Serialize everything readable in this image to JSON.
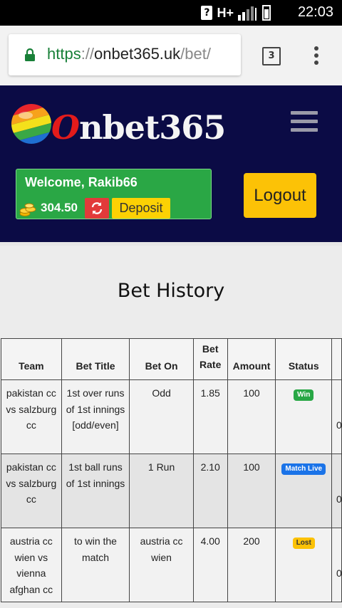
{
  "status_bar": {
    "time": "22:03",
    "network": "H+",
    "sim_icon": "sim-icon"
  },
  "browser": {
    "url_scheme": "https",
    "url_sep": "://",
    "url_host": "onbet365.uk",
    "url_path": "/bet/",
    "tab_count": "3"
  },
  "site": {
    "logo_first": "O",
    "logo_rest": "nbet365",
    "welcome": "Welcome, Rakib66",
    "balance": "304.50",
    "deposit_label": "Deposit",
    "logout_label": "Logout"
  },
  "page": {
    "title": "Bet History"
  },
  "table": {
    "headers": {
      "team": "Team",
      "bet_title": "Bet Title",
      "bet_on": "Bet On",
      "bet_rate": "Bet Rate",
      "amount": "Amount",
      "status": "Status"
    },
    "rows": [
      {
        "team": "pakistan cc vs salzburg cc",
        "bet_title": "1st over runs of 1st innings [odd/even]",
        "bet_on": "Odd",
        "bet_rate": "1.85",
        "amount": "100",
        "status": "Win",
        "extra": "0"
      },
      {
        "team": "pakistan cc vs salzburg cc",
        "bet_title": "1st ball runs of 1st innings",
        "bet_on": "1 Run",
        "bet_rate": "2.10",
        "amount": "100",
        "status": "Match Live",
        "extra": "0"
      },
      {
        "team": "austria cc wien vs vienna afghan cc",
        "bet_title": "to win the match",
        "bet_on": "austria cc wien",
        "bet_rate": "4.00",
        "amount": "200",
        "status": "Lost",
        "extra": "0"
      }
    ]
  },
  "colors": {
    "header_bg": "#0b0b45",
    "win": "#28a745",
    "live": "#1a73e8",
    "lost": "#fcc206"
  }
}
